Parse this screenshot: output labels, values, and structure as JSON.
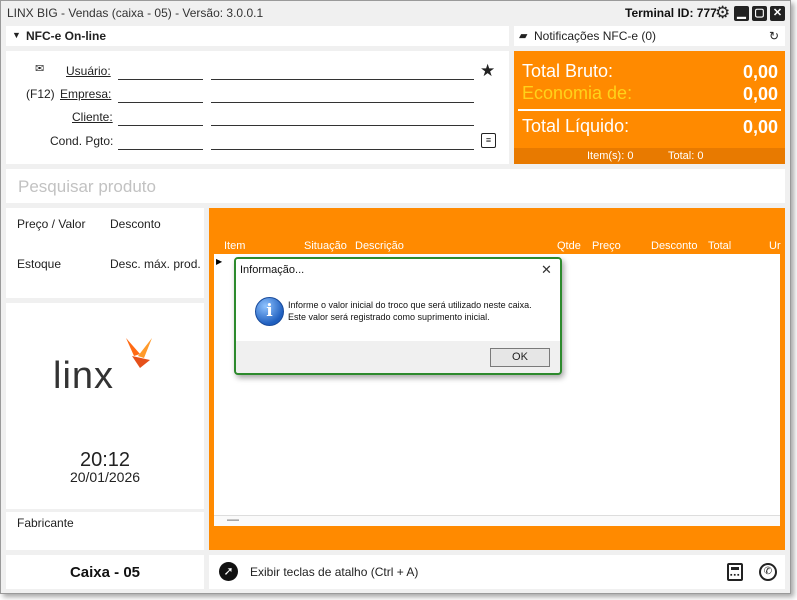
{
  "window": {
    "title": "LINX BIG - Vendas (caixa - 05) - Versão: 3.0.0.1",
    "terminal": "Terminal ID: 777"
  },
  "nfce": {
    "label": "NFC-e On-line"
  },
  "notifications": {
    "label": "Notificações NFC-e (0)"
  },
  "form": {
    "usuario": "Usuário:",
    "empresa_key": "(F12)",
    "empresa": "Empresa:",
    "cliente": "Cliente:",
    "cond_pgto": "Cond. Pgto:"
  },
  "totals": {
    "bruto_label": "Total Bruto:",
    "bruto_value": "0,00",
    "economia_label": "Economia de:",
    "economia_value": "0,00",
    "liquido_label": "Total Líquido:",
    "liquido_value": "0,00",
    "items": "Item(s): 0",
    "total": "Total: 0"
  },
  "search": {
    "placeholder": "Pesquisar produto"
  },
  "info": {
    "preco_valor": "Preço / Valor",
    "desconto": "Desconto",
    "estoque": "Estoque",
    "desc_max": "Desc. máx. prod.",
    "fabricante": "Fabricante"
  },
  "brand": {
    "logo_text": "linx"
  },
  "clock": {
    "time": "20:12",
    "date": "20/01/2026"
  },
  "grid": {
    "columns": [
      "Item",
      "Situação",
      "Descrição",
      "Qtde",
      "Preço",
      "Desconto",
      "Total",
      "Ur"
    ],
    "footer_dash": "—"
  },
  "caixa": {
    "label": "Caixa - 05"
  },
  "shortcuts": {
    "label": "Exibir teclas de atalho (Ctrl + A)"
  },
  "dialog": {
    "title": "Informação...",
    "message_line1": "Informe o valor inicial do troco que será utilizado neste caixa.",
    "message_line2": "Este valor será registrado como suprimento inicial.",
    "ok": "OK"
  },
  "colors": {
    "accent": "#ff8a00",
    "economia": "#ffd21a",
    "dialog_border": "#2d8a2d"
  }
}
